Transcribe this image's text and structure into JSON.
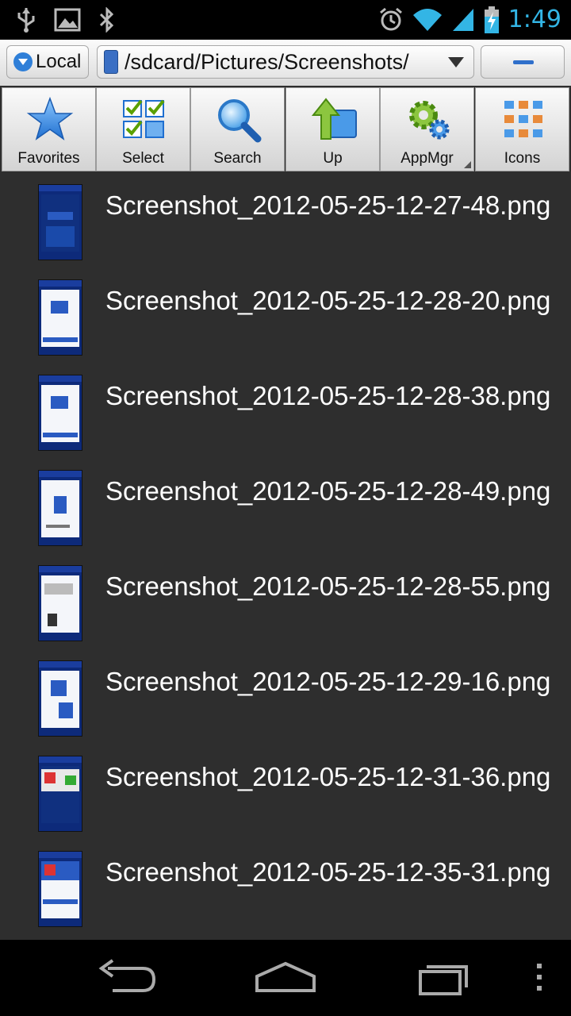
{
  "status_bar": {
    "time": "1:49",
    "icons": [
      "usb-icon",
      "image-icon",
      "bluetooth-icon",
      "alarm-icon",
      "wifi-icon",
      "signal-icon",
      "battery-charging-icon"
    ]
  },
  "path_bar": {
    "location_label": "Local",
    "path": "/sdcard/Pictures/Screenshots/"
  },
  "toolbar": {
    "buttons": [
      {
        "label": "Favorites",
        "icon": "star-icon"
      },
      {
        "label": "Select",
        "icon": "checkbox-grid-icon"
      },
      {
        "label": "Search",
        "icon": "magnifier-icon"
      },
      {
        "label": "Up",
        "icon": "up-folder-icon"
      },
      {
        "label": "AppMgr",
        "icon": "gears-icon"
      },
      {
        "label": "Icons",
        "icon": "grid-view-icon"
      }
    ]
  },
  "files": [
    {
      "name": "Screenshot_2012-05-25-12-27-48.png",
      "thumb": "dark"
    },
    {
      "name": "Screenshot_2012-05-25-12-28-20.png",
      "thumb": "light"
    },
    {
      "name": "Screenshot_2012-05-25-12-28-38.png",
      "thumb": "light"
    },
    {
      "name": "Screenshot_2012-05-25-12-28-49.png",
      "thumb": "light"
    },
    {
      "name": "Screenshot_2012-05-25-12-28-55.png",
      "thumb": "light"
    },
    {
      "name": "Screenshot_2012-05-25-12-29-16.png",
      "thumb": "light"
    },
    {
      "name": "Screenshot_2012-05-25-12-31-36.png",
      "thumb": "dark"
    },
    {
      "name": "Screenshot_2012-05-25-12-35-31.png",
      "thumb": "light"
    }
  ],
  "nav_bar": {
    "buttons": [
      "back-icon",
      "home-icon",
      "recents-icon",
      "menu-icon"
    ]
  },
  "colors": {
    "clock": "#33b5e5",
    "list_background": "#2e2e2e",
    "accent_blue": "#2f7fd8"
  }
}
